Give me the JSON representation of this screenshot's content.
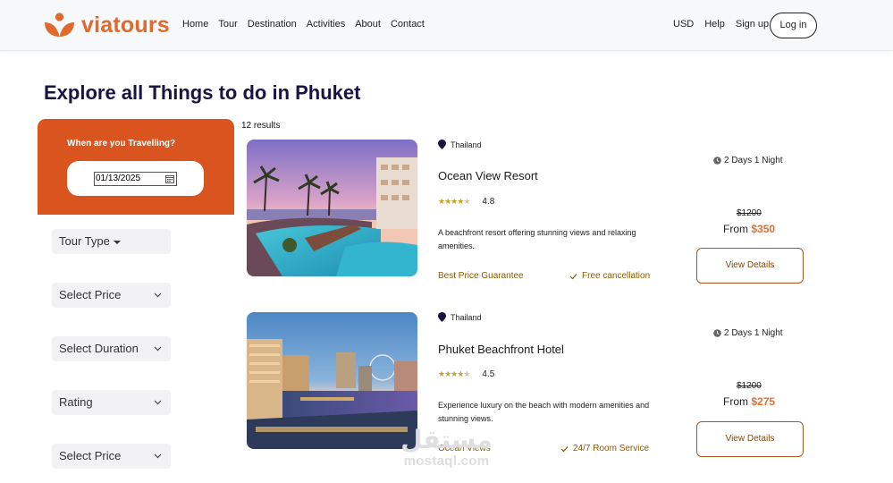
{
  "header": {
    "logo_text": "viatours",
    "nav": [
      "Home",
      "Tour",
      "Destination",
      "Activities",
      "About",
      "Contact"
    ],
    "right_nav": [
      "USD",
      "Help",
      "Sign up"
    ],
    "login_label": "Log in"
  },
  "page_title": "Explore all Things to do in Phuket",
  "sidebar": {
    "travel_label": "When are you Travelling?",
    "date_value": "01/13/2025",
    "filters": [
      "Tour Type",
      "Select Price",
      "Select Duration",
      "Rating",
      "Select Price"
    ]
  },
  "results_count": "12 results",
  "cards": [
    {
      "location": "Thailand",
      "title": "Ocean View Resort",
      "rating": "4.8",
      "stars_filled": 4,
      "description": "A beachfront resort offering stunning views and relaxing amenities.",
      "guarantee": "Best Price Guarantee",
      "feature": "Free cancellation",
      "duration": "2 Days 1 Night",
      "old_price": "$1200",
      "from_label": "From",
      "price": "$350",
      "button_label": "View Details"
    },
    {
      "location": "Thailand",
      "title": "Phuket Beachfront Hotel",
      "rating": "4.5",
      "stars_filled": 4,
      "description": "Experience luxury on the beach with modern amenities and stunning views.",
      "guarantee": "Ocean Views",
      "feature": "24/7 Room Service",
      "duration": "2 Days 1 Night",
      "old_price": "$1200",
      "from_label": "From",
      "price": "$275",
      "button_label": "View Details"
    }
  ],
  "watermark": {
    "arabic": "مستقل",
    "latin": "mostaql.com"
  },
  "colors": {
    "brand": "#e06a2b",
    "sidebar": "#d9541e",
    "title": "#1a1442",
    "price": "#e07030"
  }
}
